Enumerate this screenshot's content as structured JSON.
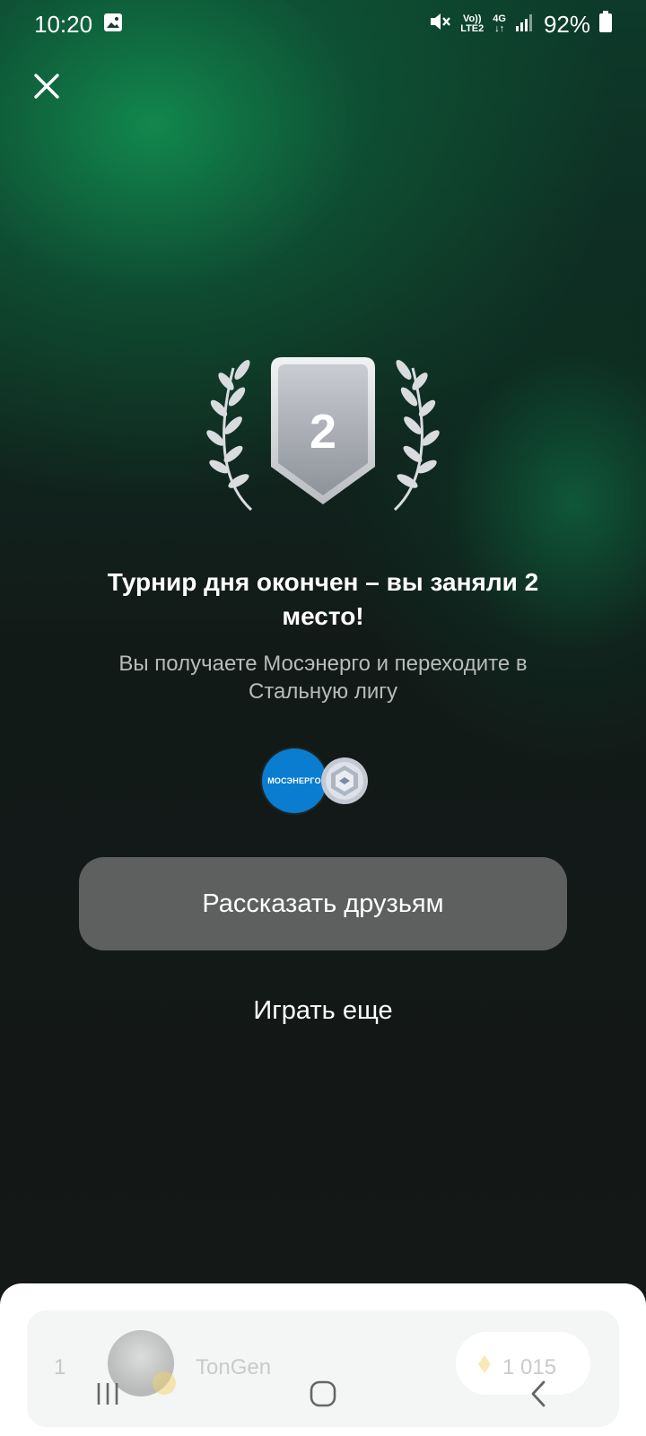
{
  "status_bar": {
    "time": "10:20",
    "volte_label_top": "Vo))",
    "volte_label_bottom": "LTE2",
    "network_label": "4G",
    "battery_percent": "92%",
    "icons": [
      "gallery-icon",
      "mute-icon",
      "signal-icon",
      "battery-icon"
    ]
  },
  "result": {
    "place_number": "2",
    "title": "Турнир дня окончен – вы заняли 2 место!",
    "subtitle": "Вы получаете Мосэнерго и переходите в Стальную лигу",
    "reward_logo_text": "МОСЭНЕРГО"
  },
  "actions": {
    "share_label": "Рассказать друзьям",
    "play_again_label": "Играть еще"
  },
  "leaderboard": {
    "rows": [
      {
        "rank": "1",
        "name": "TonGen",
        "score": "1 015"
      }
    ]
  },
  "colors": {
    "accent_green": "#128c50",
    "button_gray": "#5d605f",
    "reward_blue": "#0a7dd0",
    "subtitle_gray": "#b7bcba"
  }
}
